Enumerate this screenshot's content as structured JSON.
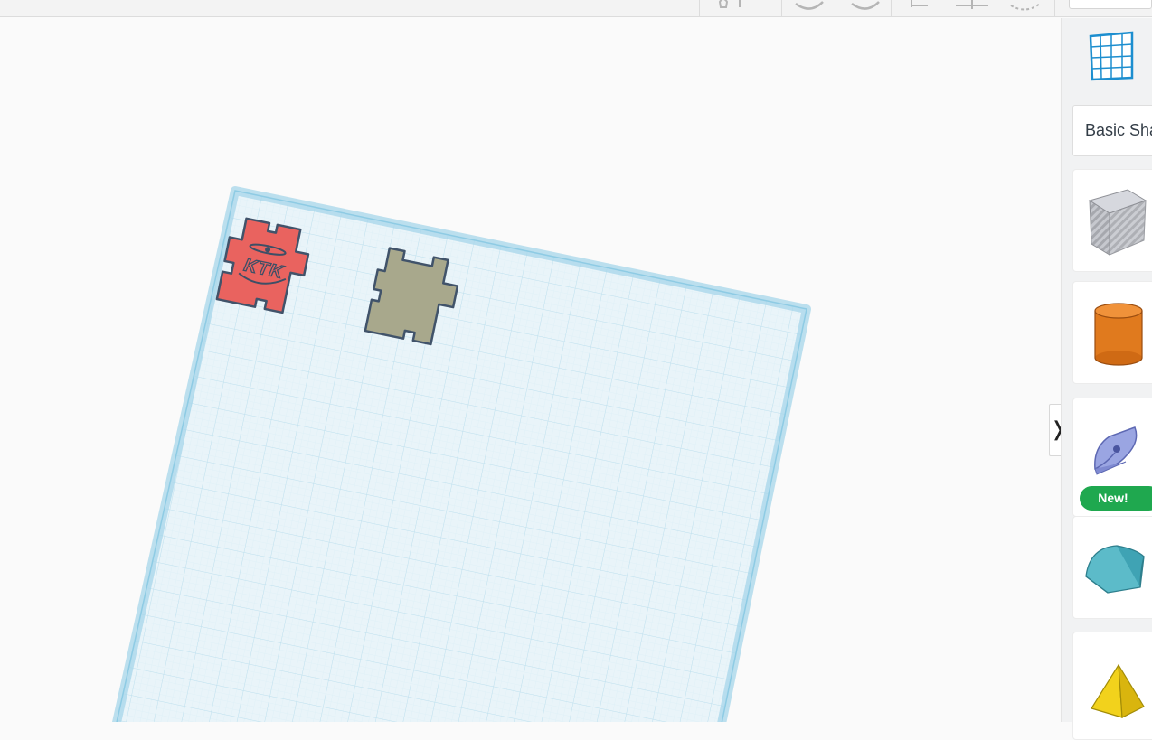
{
  "sidebar": {
    "grid_icon": "workplane-grid-icon",
    "category_label": "Basic Shapes",
    "shapes": [
      {
        "name": "box",
        "icon": "box-icon"
      },
      {
        "name": "cylinder",
        "icon": "cylinder-icon"
      },
      {
        "name": "scribble",
        "icon": "scribble-pen-icon",
        "badge": "New!"
      },
      {
        "name": "roof",
        "icon": "roof-icon"
      },
      {
        "name": "pyramid",
        "icon": "pyramid-icon"
      }
    ],
    "collapse_glyph": "❭"
  },
  "canvas": {
    "red_piece_text": "KTK",
    "colors": {
      "plane": "#e6f3f8",
      "plane_border": "#a9d8ec",
      "grid": "#cde7f1",
      "red_piece": "#e96461",
      "olive_piece": "#a7a78b",
      "outline": "#3f5267"
    }
  }
}
